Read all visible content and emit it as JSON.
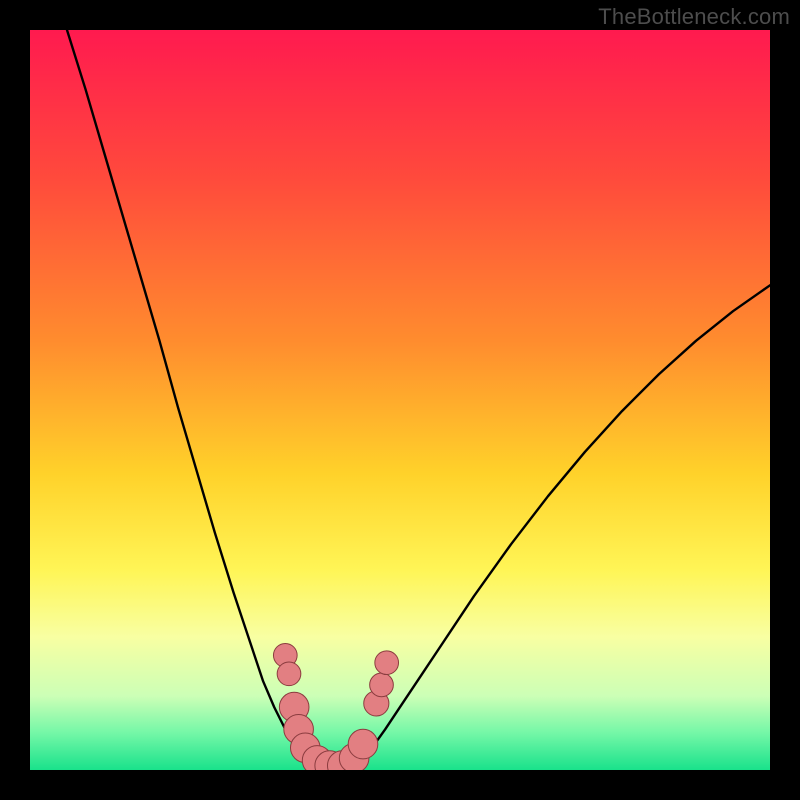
{
  "watermark": "TheBottleneck.com",
  "colors": {
    "frame": "#000000",
    "curve": "#000000",
    "marker_fill": "#e27f82",
    "marker_stroke": "#8b3c3f",
    "gradient_stops": [
      {
        "offset": 0.0,
        "color": "#ff1a4f"
      },
      {
        "offset": 0.2,
        "color": "#ff4a3c"
      },
      {
        "offset": 0.42,
        "color": "#ff8c2e"
      },
      {
        "offset": 0.6,
        "color": "#ffd22a"
      },
      {
        "offset": 0.73,
        "color": "#fff556"
      },
      {
        "offset": 0.82,
        "color": "#f8ffa2"
      },
      {
        "offset": 0.9,
        "color": "#ccffb6"
      },
      {
        "offset": 0.95,
        "color": "#74f7a7"
      },
      {
        "offset": 1.0,
        "color": "#19e28b"
      }
    ]
  },
  "chart_data": {
    "type": "line",
    "title": "",
    "xlabel": "",
    "ylabel": "",
    "xlim": [
      0,
      100
    ],
    "ylim": [
      0,
      100
    ],
    "series": [
      {
        "name": "left-curve",
        "x": [
          5.0,
          7.5,
          10.0,
          12.5,
          15.0,
          17.5,
          20.0,
          22.5,
          25.0,
          27.5,
          30.0,
          31.5,
          33.0,
          34.5,
          36.0,
          37.0,
          38.0,
          39.0,
          40.0
        ],
        "y": [
          100.0,
          92.0,
          83.5,
          75.0,
          66.5,
          58.0,
          49.0,
          40.5,
          32.0,
          24.0,
          16.5,
          12.0,
          8.5,
          5.5,
          3.2,
          2.0,
          1.2,
          0.6,
          0.25
        ]
      },
      {
        "name": "right-curve",
        "x": [
          43.0,
          44.0,
          45.0,
          46.5,
          48.0,
          50.0,
          53.0,
          56.0,
          60.0,
          65.0,
          70.0,
          75.0,
          80.0,
          85.0,
          90.0,
          95.0,
          100.0
        ],
        "y": [
          0.25,
          0.8,
          1.8,
          3.4,
          5.5,
          8.5,
          13.0,
          17.5,
          23.5,
          30.5,
          37.0,
          43.0,
          48.5,
          53.5,
          58.0,
          62.0,
          65.5
        ]
      },
      {
        "name": "floor-segment",
        "x": [
          40.0,
          41.0,
          42.0,
          43.0
        ],
        "y": [
          0.25,
          0.2,
          0.2,
          0.25
        ]
      }
    ],
    "markers": [
      {
        "x": 34.5,
        "y": 15.5,
        "r": 1.6
      },
      {
        "x": 35.0,
        "y": 13.0,
        "r": 1.6
      },
      {
        "x": 35.7,
        "y": 8.5,
        "r": 2.0
      },
      {
        "x": 36.3,
        "y": 5.5,
        "r": 2.0
      },
      {
        "x": 37.2,
        "y": 3.0,
        "r": 2.0
      },
      {
        "x": 38.8,
        "y": 1.3,
        "r": 2.0
      },
      {
        "x": 40.5,
        "y": 0.6,
        "r": 2.0
      },
      {
        "x": 42.2,
        "y": 0.6,
        "r": 2.0
      },
      {
        "x": 43.8,
        "y": 1.6,
        "r": 2.0
      },
      {
        "x": 45.0,
        "y": 3.5,
        "r": 2.0
      },
      {
        "x": 46.8,
        "y": 9.0,
        "r": 1.7
      },
      {
        "x": 47.5,
        "y": 11.5,
        "r": 1.6
      },
      {
        "x": 48.2,
        "y": 14.5,
        "r": 1.6
      }
    ]
  }
}
